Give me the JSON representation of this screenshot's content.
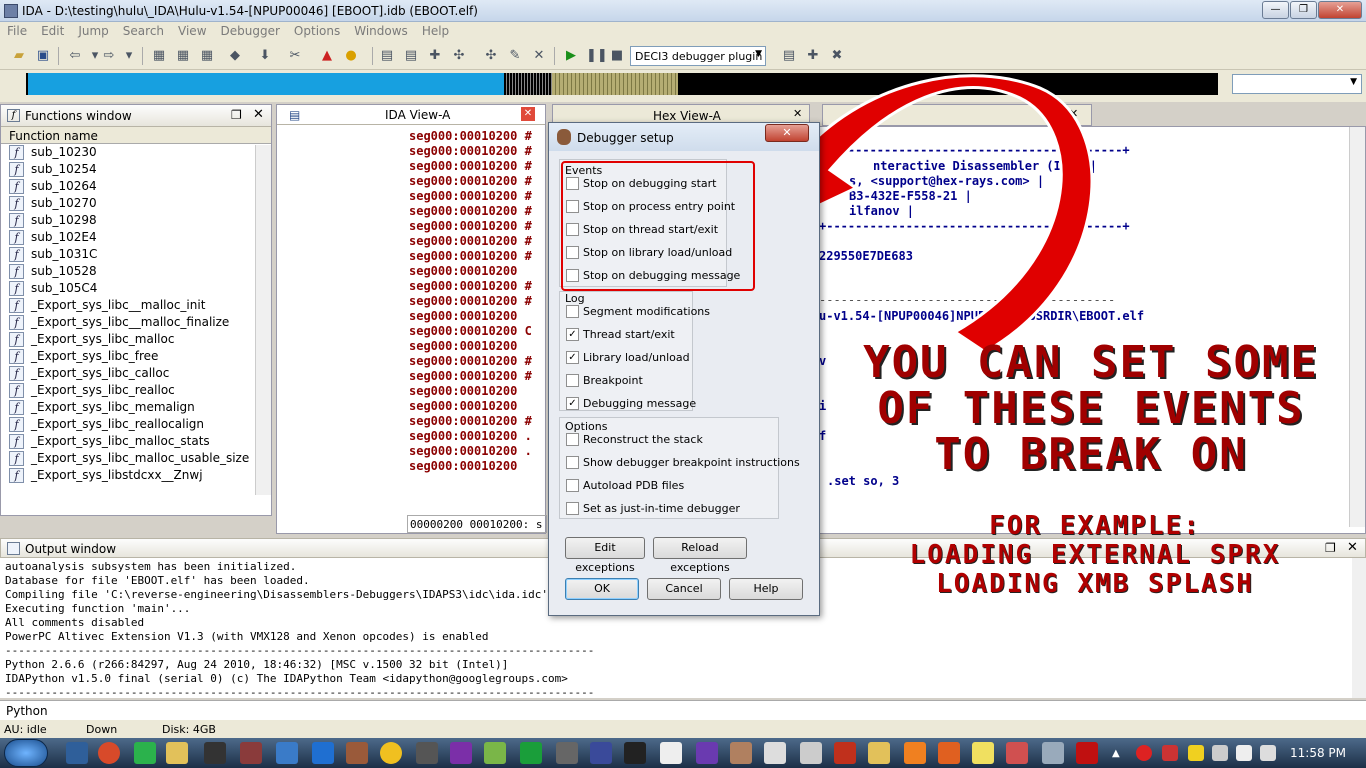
{
  "window": {
    "title": "IDA - D:\\testing\\hulu\\_IDA\\Hulu-v1.54-[NPUP00046] [EBOOT].idb (EBOOT.elf)",
    "close": "✕",
    "maximize": "❐",
    "minimize": "—"
  },
  "menu": [
    "File",
    "Edit",
    "Jump",
    "Search",
    "View",
    "Debugger",
    "Options",
    "Windows",
    "Help"
  ],
  "toolbar": {
    "debugger_plugin": "DECI3 debugger plugin"
  },
  "functions": {
    "title": "Functions window",
    "column": "Function name",
    "items": [
      "sub_10230",
      "sub_10254",
      "sub_10264",
      "sub_10270",
      "sub_10298",
      "sub_102E4",
      "sub_1031C",
      "sub_10528",
      "sub_105C4",
      "_Export_sys_libc__malloc_init",
      "_Export_sys_libc__malloc_finalize",
      "_Export_sys_libc_malloc",
      "_Export_sys_libc_free",
      "_Export_sys_libc_calloc",
      "_Export_sys_libc_realloc",
      "_Export_sys_libc_memalign",
      "_Export_sys_libc_reallocalign",
      "_Export_sys_libc_malloc_stats",
      "_Export_sys_libc_malloc_usable_size",
      "_Export_sys_libstdcxx__Znwj"
    ]
  },
  "ida_view": {
    "tab": "IDA View-A",
    "lines": [
      "seg000:00010200 #",
      "seg000:00010200 #",
      "seg000:00010200 #",
      "seg000:00010200 #",
      "seg000:00010200 #",
      "seg000:00010200 #",
      "seg000:00010200 #",
      "seg000:00010200 #",
      "seg000:00010200 #",
      "seg000:00010200",
      "seg000:00010200 #",
      "seg000:00010200 #",
      "seg000:00010200",
      "seg000:00010200 C",
      "seg000:00010200",
      "seg000:00010200 #",
      "seg000:00010200 #",
      "seg000:00010200",
      "seg000:00010200",
      "seg000:00010200 #",
      "seg000:00010200 .",
      "seg000:00010200 .",
      "seg000:00010200"
    ],
    "status": "00000200 00010200: s"
  },
  "hex_view": {
    "tab": "Hex View-A"
  },
  "right_pane": {
    "lines": [
      "+-----------------------------------------+",
      "nteractive Disassembler (IDA)    |",
      "s, <support@hex-rays.com>        |",
      "B3-432E-F558-21                  |",
      "ilfanov                          |",
      "+-----------------------------------------+",
      "229550E7DE683",
      "-----------------------------------------",
      "u-v1.54-[NPUP00046]NPUP00046\\USRDIR\\EBOOT.elf",
      "v",
      "i",
      "f",
      ".set so, 3"
    ]
  },
  "output": {
    "title": "Output window",
    "lines": [
      "autoanalysis subsystem has been initialized.",
      "Database for file 'EBOOT.elf' has been loaded.",
      "Compiling file 'C:\\reverse-engineering\\Disassemblers-Debuggers\\IDAPS3\\idc\\ida.idc'...",
      "Executing function 'main'...",
      "All comments disabled",
      "PowerPC Altivec Extension V1.3 (with VMX128 and Xenon opcodes) is enabled",
      "-----------------------------------------------------------------------------------------",
      "Python 2.6.6 (r266:84297, Aug 24 2010, 18:46:32) [MSC v.1500 32 bit (Intel)]",
      "IDAPython v1.5.0 final (serial 0) (c) The IDAPython Team <idapython@googlegroups.com>",
      "-----------------------------------------------------------------------------------------"
    ]
  },
  "python_label": "Python",
  "status": {
    "au": "AU:  idle",
    "state": "Down",
    "disk": "Disk: 4GB"
  },
  "clock": "11:58 PM",
  "dialog": {
    "title": "Debugger setup",
    "events_label": "Events",
    "events": [
      {
        "label": "Stop on debugging start",
        "checked": false
      },
      {
        "label": "Stop on process entry point",
        "checked": false
      },
      {
        "label": "Stop on thread start/exit",
        "checked": false
      },
      {
        "label": "Stop on library load/unload",
        "checked": false
      },
      {
        "label": "Stop on debugging message",
        "checked": false
      }
    ],
    "log_label": "Log",
    "log": [
      {
        "label": "Segment modifications",
        "checked": false
      },
      {
        "label": "Thread start/exit",
        "checked": true
      },
      {
        "label": "Library load/unload",
        "checked": true
      },
      {
        "label": "Breakpoint",
        "checked": false
      },
      {
        "label": "Debugging message",
        "checked": true
      }
    ],
    "options_label": "Options",
    "options": [
      {
        "label": "Reconstruct the stack",
        "checked": false
      },
      {
        "label": "Show debugger breakpoint instructions",
        "checked": false
      },
      {
        "label": "Autoload PDB files",
        "checked": false
      },
      {
        "label": "Set as just-in-time debugger",
        "checked": false
      }
    ],
    "edit_exceptions": "Edit exceptions",
    "reload_exceptions": "Reload exceptions",
    "ok": "OK",
    "cancel": "Cancel",
    "help": "Help"
  },
  "annotation": {
    "line1": "YOU CAN SET SOME",
    "line2": "OF THESE EVENTS",
    "line3": "TO BREAK ON",
    "line4": "FOR EXAMPLE:",
    "line5": "LOADING EXTERNAL SPRX",
    "line6": "LOADING XMB SPLASH",
    "color": "#e00000"
  }
}
